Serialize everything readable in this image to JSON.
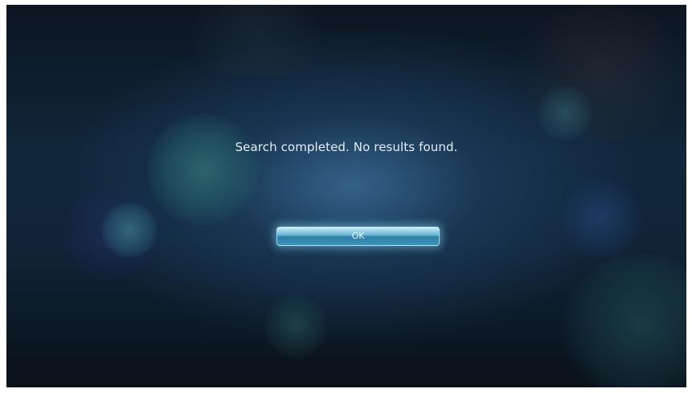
{
  "dialog": {
    "message": "Search completed. No results found.",
    "ok_label": "OK"
  },
  "colors": {
    "background_dark": "#0d1520",
    "background_glow": "#3a6c96",
    "button_accent": "#4fa7c9",
    "text": "#e4edf3"
  }
}
